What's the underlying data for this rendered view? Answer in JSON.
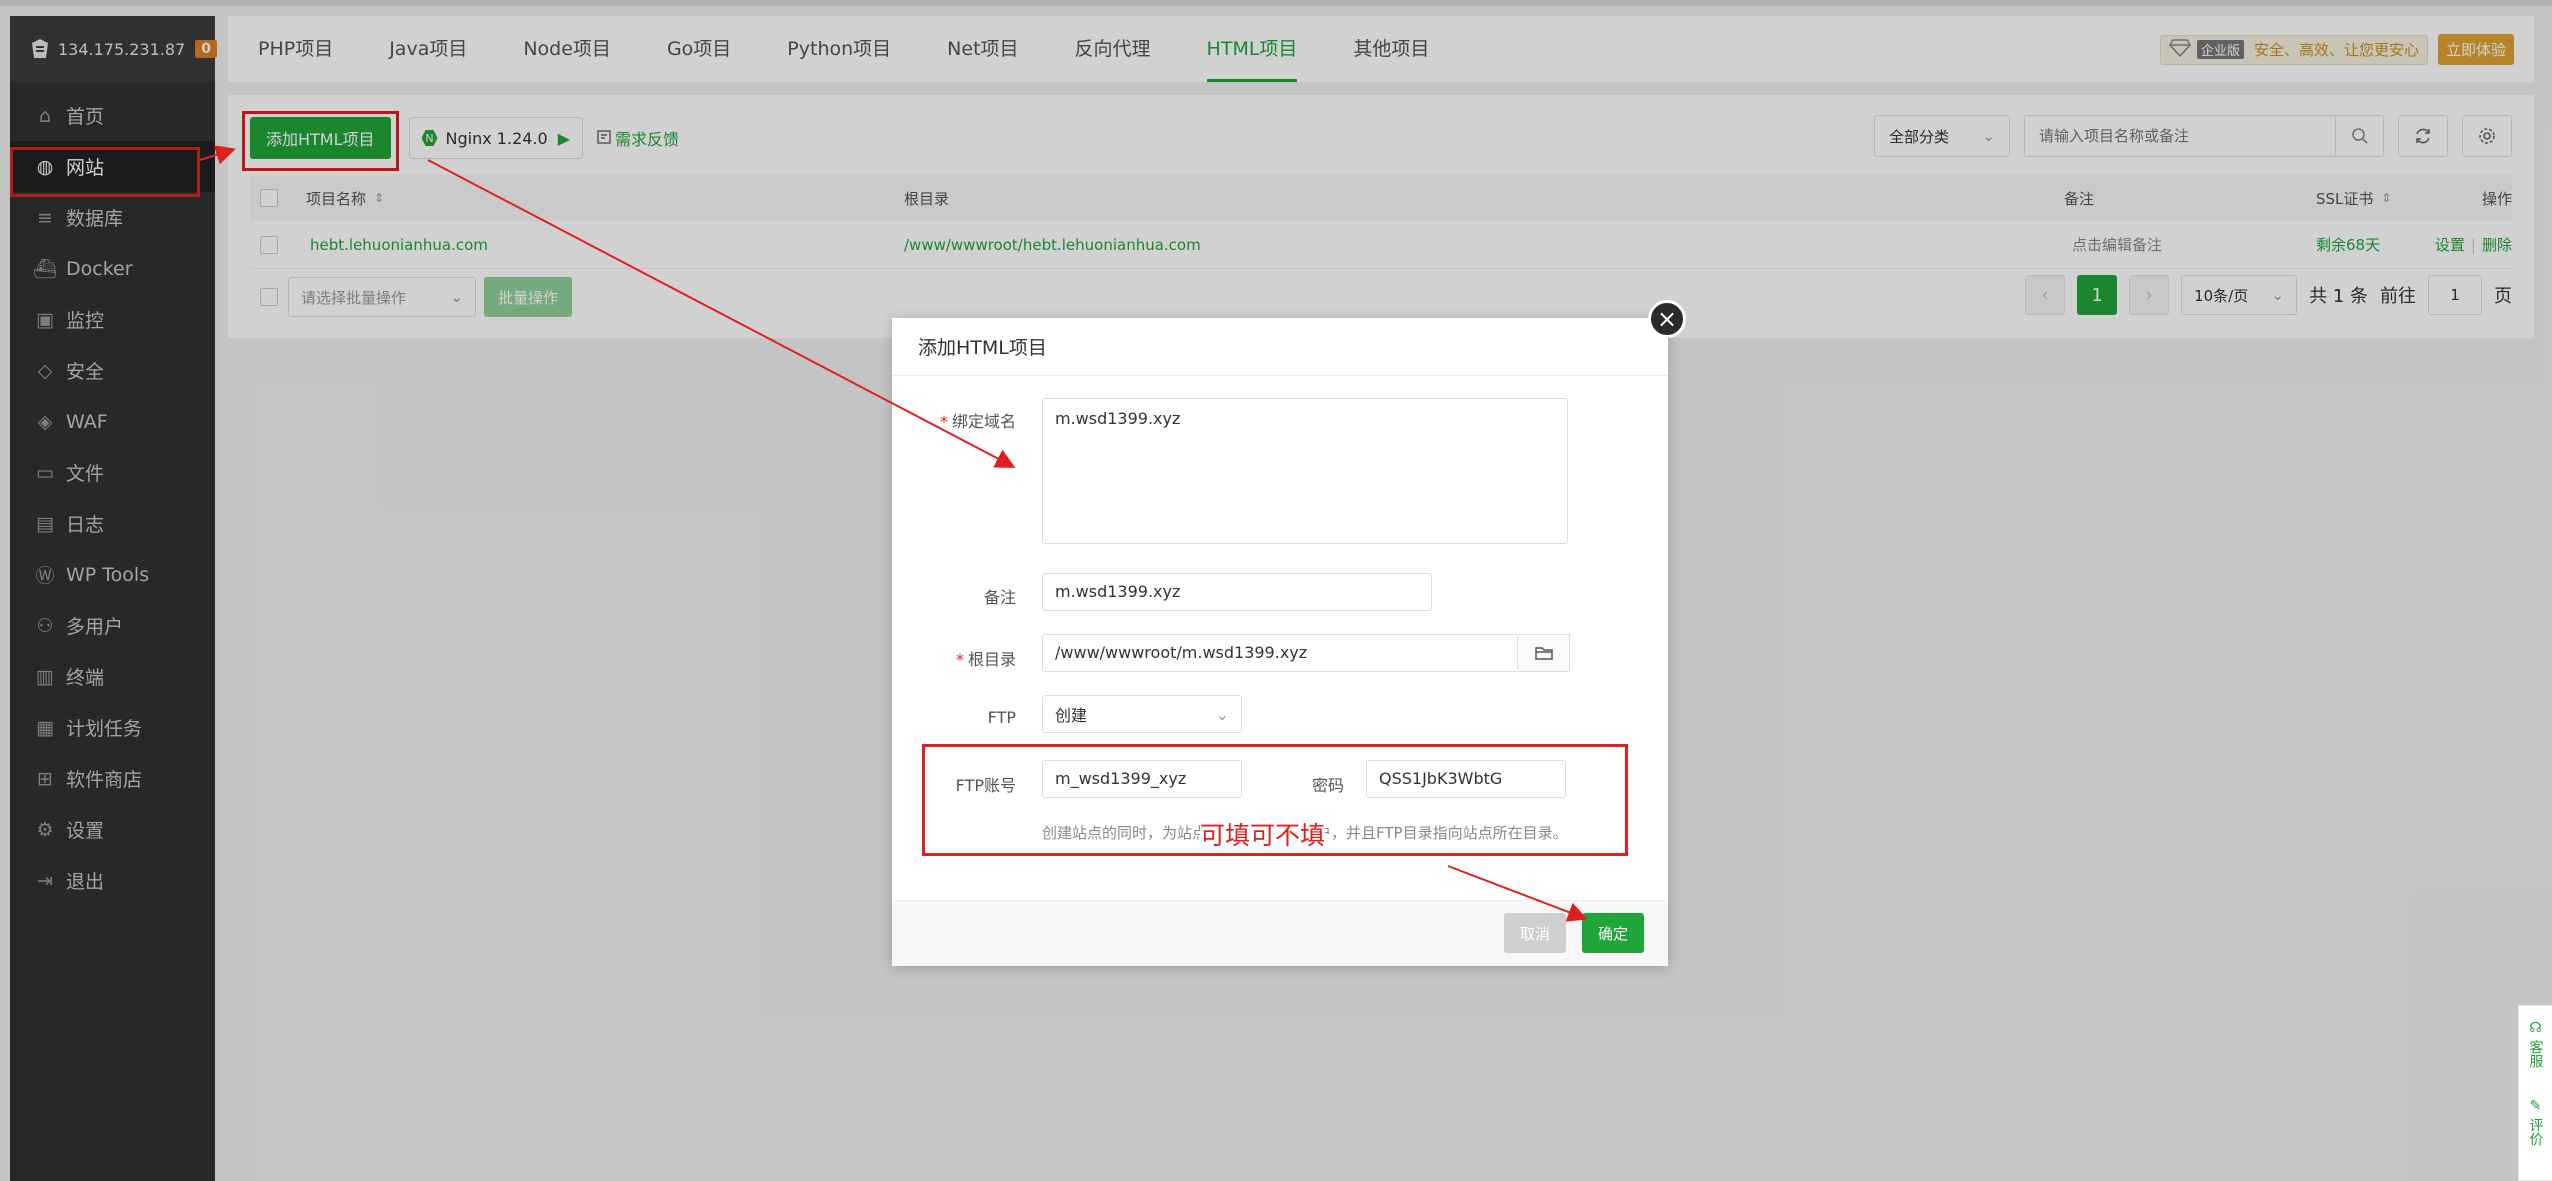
{
  "server": {
    "ip": "134.175.231.87",
    "badge": "0"
  },
  "sidebar": {
    "items": [
      {
        "label": "首页",
        "icon": "home-icon"
      },
      {
        "label": "网站",
        "icon": "globe-icon",
        "active": true
      },
      {
        "label": "数据库",
        "icon": "database-icon"
      },
      {
        "label": "Docker",
        "icon": "docker-icon"
      },
      {
        "label": "监控",
        "icon": "monitor-icon"
      },
      {
        "label": "安全",
        "icon": "shield-icon"
      },
      {
        "label": "WAF",
        "icon": "waf-shield-icon"
      },
      {
        "label": "文件",
        "icon": "folder-icon"
      },
      {
        "label": "日志",
        "icon": "log-icon"
      },
      {
        "label": "WP Tools",
        "icon": "wordpress-icon"
      },
      {
        "label": "多用户",
        "icon": "users-icon"
      },
      {
        "label": "终端",
        "icon": "terminal-icon"
      },
      {
        "label": "计划任务",
        "icon": "calendar-icon"
      },
      {
        "label": "软件商店",
        "icon": "apps-icon"
      },
      {
        "label": "设置",
        "icon": "gear-icon"
      },
      {
        "label": "退出",
        "icon": "logout-icon"
      }
    ]
  },
  "tabs": [
    {
      "label": "PHP项目"
    },
    {
      "label": "Java项目"
    },
    {
      "label": "Node项目"
    },
    {
      "label": "Go项目"
    },
    {
      "label": "Python项目"
    },
    {
      "label": "Net项目"
    },
    {
      "label": "反向代理"
    },
    {
      "label": "HTML项目",
      "active": true
    },
    {
      "label": "其他项目"
    }
  ],
  "header": {
    "edition_tag": "企业版",
    "slogan": "安全、高效、让您更安心",
    "trial_label": "立即体验"
  },
  "toolbar": {
    "add_label": "添加HTML项目",
    "nginx_label": "Nginx 1.24.0",
    "feedback_label": "需求反馈",
    "category_label": "全部分类",
    "search_placeholder": "请输入项目名称或备注"
  },
  "table": {
    "columns": {
      "name": "项目名称",
      "root": "根目录",
      "remark": "备注",
      "ssl": "SSL证书",
      "actions": "操作"
    },
    "rows": [
      {
        "name": "hebt.lehuonianhua.com",
        "root": "/www/wwwroot/hebt.lehuonianhua.com",
        "remark": "点击编辑备注",
        "ssl": "剩余68天",
        "settings": "设置",
        "delete": "删除"
      }
    ]
  },
  "footer": {
    "batch_placeholder": "请选择批量操作",
    "batch_button": "批量操作",
    "current_page": "1",
    "page_size": "10条/页",
    "total": "共 1 条",
    "goto_prefix": "前往",
    "goto_value": "1",
    "goto_suffix": "页"
  },
  "modal": {
    "title": "添加HTML项目",
    "domain_label": "绑定域名",
    "domain_value": "m.wsd1399.xyz",
    "remark_label": "备注",
    "remark_value": "m.wsd1399.xyz",
    "root_label": "根目录",
    "root_value": "/www/wwwroot/m.wsd1399.xyz",
    "ftp_label": "FTP",
    "ftp_value": "创建",
    "ftp_account_label": "FTP账号",
    "ftp_account_value": "m_wsd1399_xyz",
    "password_label": "密码",
    "password_value": "QSS1JbK3WbtG",
    "help_part1": "创建站点的同时，为站点",
    "help_part2": "帐户，并且FTP目录指向站点所在目录。",
    "cancel_label": "取消",
    "ok_label": "确定"
  },
  "annotation": {
    "text": "可填可不填",
    "color": "#e02020"
  },
  "side_float": {
    "service": "客服",
    "review": "评价"
  },
  "colors": {
    "accent": "#20a53a",
    "sidebar": "#2f3133",
    "highlight": "#e02020"
  }
}
